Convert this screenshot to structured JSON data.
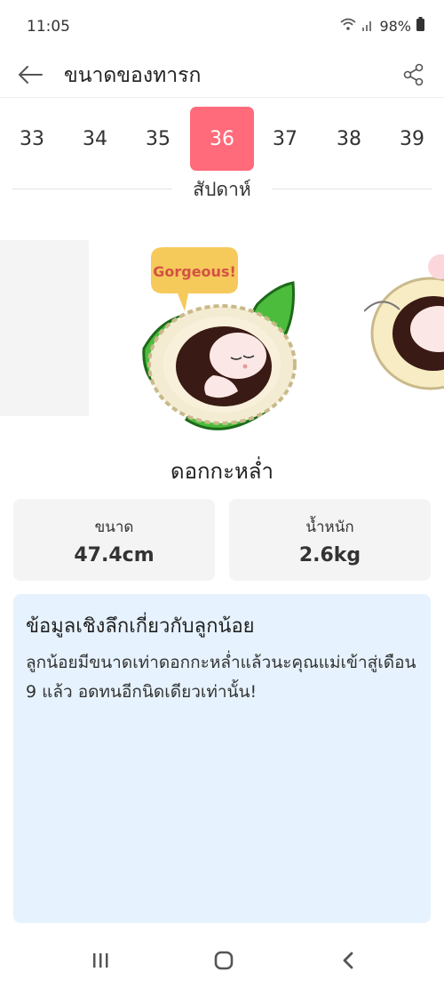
{
  "status_bar": {
    "time": "11:05",
    "battery": "98%"
  },
  "header": {
    "title": "ขนาดของทารก"
  },
  "weeks": {
    "items": [
      "33",
      "34",
      "35",
      "36",
      "37",
      "38",
      "39"
    ],
    "selected": "36",
    "unit_label": "สัปดาห์"
  },
  "illustration": {
    "speech_bubble": "Gorgeous!"
  },
  "fruit": {
    "name": "ดอกกะหล่ำ"
  },
  "stats": {
    "size_label": "ขนาด",
    "size_value": "47.4cm",
    "weight_label": "น้ำหนัก",
    "weight_value": "2.6kg"
  },
  "insight": {
    "title": "ข้อมูลเชิงลึกเกี่ยวกับลูกน้อย",
    "text": "ลูกน้อยมีขนาดเท่าดอกกะหล่ำแล้วนะคุณแม่เข้าสู่เดือน 9 แล้ว อดทนอีกนิดเดียวเท่านั้น!"
  },
  "colors": {
    "accent": "#ff6b7a",
    "insight_bg": "#e6f2fd",
    "card_bg": "#f4f4f5"
  }
}
